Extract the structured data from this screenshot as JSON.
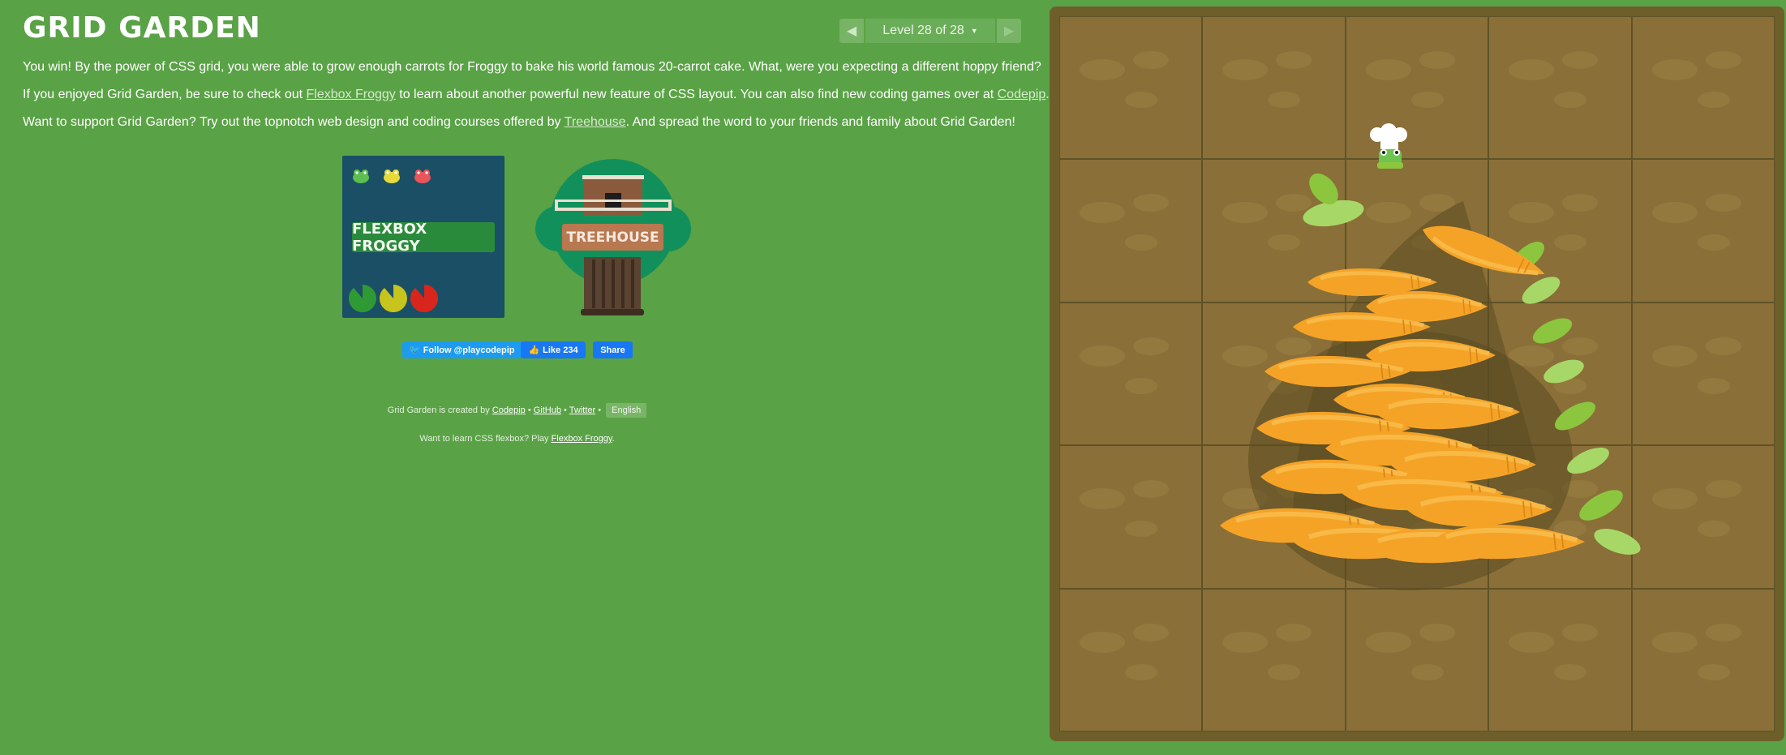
{
  "header": {
    "title": "GRID GARDEN",
    "level": {
      "prev_icon": "◀",
      "label": "Level 28 of 28",
      "caret": "▼",
      "next_icon": "▶",
      "current": 28,
      "total": 28
    }
  },
  "content": {
    "p1": "You win! By the power of CSS grid, you were able to grow enough carrots for Froggy to bake his world famous 20-carrot cake. What, were you expecting a different hoppy friend?",
    "p2_a": "If you enjoyed Grid Garden, be sure to check out ",
    "p2_link1": "Flexbox Froggy",
    "p2_b": " to learn about another powerful new feature of CSS layout. You can also find new coding games over at ",
    "p2_link2": "Codepip",
    "p2_c": ".",
    "p3_a": "Want to support Grid Garden? Try out the topnotch web design and coding courses offered by ",
    "p3_link": "Treehouse",
    "p3_b": ". And spread the word to your friends and family about Grid Garden!"
  },
  "promos": {
    "froggy_label": "FLEXBOX FROGGY",
    "treehouse_label": "TREEHOUSE"
  },
  "social": {
    "twitter": "Follow @playcodepip",
    "fb_like": "Like 234",
    "fb_share": "Share"
  },
  "footer": {
    "line1_a": "Grid Garden is created by ",
    "codepip": "Codepip",
    "sep": " • ",
    "github": "GitHub",
    "twitter": "Twitter",
    "language": "English",
    "line2_a": "Want to learn CSS flexbox? Play ",
    "froggy_link": "Flexbox Froggy",
    "line2_b": "."
  },
  "colors": {
    "background": "#5aa246",
    "soil": "#8a6f38",
    "carrot": "#f5a327",
    "leaf": "#8cc63f",
    "froggy_bg": "#1b4f66",
    "treehouse_sign": "#b87850"
  }
}
